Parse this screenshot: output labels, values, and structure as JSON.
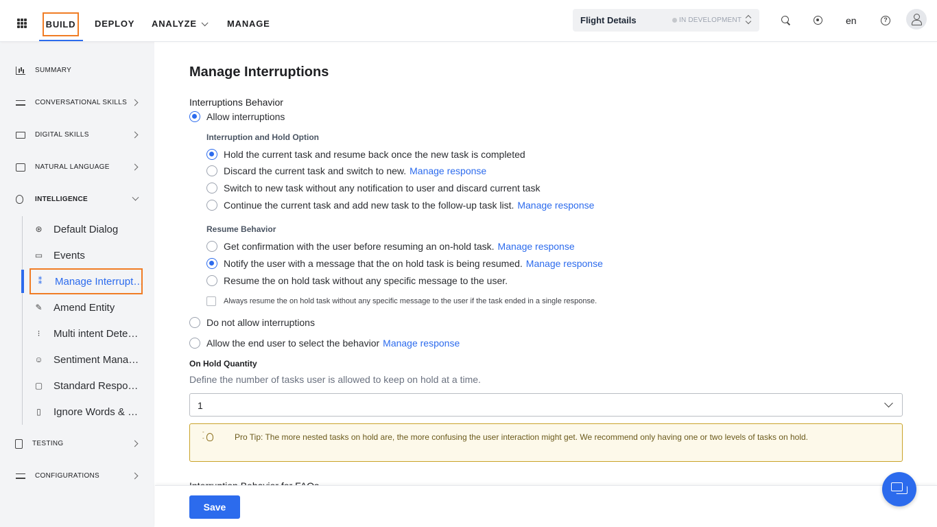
{
  "nav": {
    "build": "BUILD",
    "deploy": "DEPLOY",
    "analyze": "ANALYZE",
    "manage": "MANAGE"
  },
  "app_selector": {
    "name": "Flight Details",
    "status": "IN DEVELOPMENT"
  },
  "header_icons": {
    "language": "en"
  },
  "sidebar": {
    "items": [
      {
        "label": "SUMMARY",
        "icon": "bar-chart-icon"
      },
      {
        "label": "CONVERSATIONAL SKILLS",
        "icon": "stack-icon"
      },
      {
        "label": "DIGITAL SKILLS",
        "icon": "monitor-icon"
      },
      {
        "label": "NATURAL LANGUAGE",
        "icon": "chat-icon"
      },
      {
        "label": "INTELLIGENCE",
        "icon": "lightbulb-icon"
      },
      {
        "label": "TESTING",
        "icon": "clipboard-icon"
      },
      {
        "label": "CONFIGURATIONS",
        "icon": "stack-icon"
      }
    ],
    "subitems": [
      {
        "label": "Default Dialog",
        "icon": "lifebuoy-icon"
      },
      {
        "label": "Events",
        "icon": "events-icon"
      },
      {
        "label": "Manage Interruptions",
        "icon": "interrupt-icon"
      },
      {
        "label": "Amend Entity",
        "icon": "edit-icon"
      },
      {
        "label": "Multi intent Detection",
        "icon": "multi-intent-icon"
      },
      {
        "label": "Sentiment Management",
        "icon": "smile-icon"
      },
      {
        "label": "Standard Responses",
        "icon": "message-icon"
      },
      {
        "label": "Ignore Words & Field Memory",
        "icon": "document-icon"
      }
    ]
  },
  "main": {
    "title": "Manage Interruptions",
    "interruptions_behavior_label": "Interruptions Behavior",
    "allow_interruptions": "Allow interruptions",
    "hold_option_heading": "Interruption and Hold Option",
    "hold_options": [
      {
        "label": "Hold the current task and resume back once the new task is completed",
        "link": ""
      },
      {
        "label": "Discard the current task and switch to new.",
        "link": "Manage response"
      },
      {
        "label": "Switch to new task without any notification to user and discard current task",
        "link": ""
      },
      {
        "label": "Continue the current task and add new task to the follow-up task list.",
        "link": "Manage response"
      }
    ],
    "resume_heading": "Resume Behavior",
    "resume_options": [
      {
        "label": "Get confirmation with the user before resuming an on-hold task.",
        "link": "Manage response"
      },
      {
        "label": "Notify the user with a message that the on hold task is being resumed.",
        "link": "Manage response"
      },
      {
        "label": "Resume the on hold task without any specific message to the user.",
        "link": ""
      }
    ],
    "always_resume_checkbox": "Always resume the on hold task without any specific message to the user if the task ended in a single response.",
    "do_not_allow": "Do not allow interruptions",
    "allow_end_user": "Allow the end user to select the behavior",
    "allow_end_user_link": "Manage response",
    "on_hold_title": "On Hold Quantity",
    "on_hold_desc": "Define the number of tasks user is allowed to keep on hold at a time.",
    "on_hold_value": "1",
    "pro_tip": "Pro Tip: The more nested tasks on hold are, the more confusing the user interaction might get. We recommend only having one or two levels of tasks on hold.",
    "faq_heading": "Interruption Behavior for FAQs"
  },
  "footer": {
    "save_label": "Save"
  },
  "colors": {
    "accent": "#2c6bed",
    "highlight_border": "#f07c24",
    "tip_background": "#fdf9ea"
  }
}
